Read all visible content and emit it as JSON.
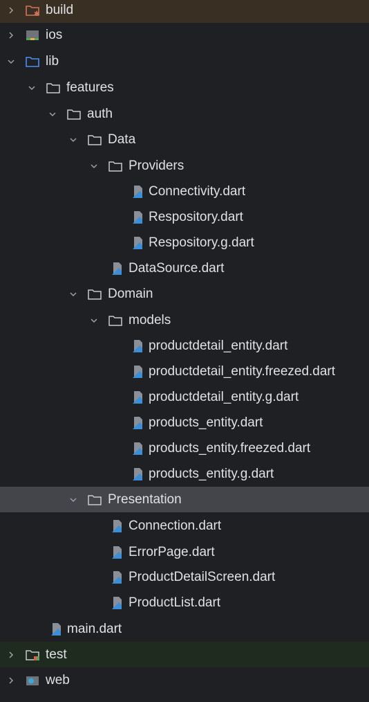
{
  "tree": {
    "rows": [
      {
        "label": "build",
        "kind": "folder-excluded",
        "expanded": false
      },
      {
        "label": "ios",
        "kind": "folder-ios",
        "expanded": false
      },
      {
        "label": "lib",
        "kind": "folder-source",
        "expanded": true
      },
      {
        "label": "features",
        "kind": "folder",
        "expanded": true
      },
      {
        "label": "auth",
        "kind": "folder",
        "expanded": true
      },
      {
        "label": "Data",
        "kind": "folder",
        "expanded": true
      },
      {
        "label": "Providers",
        "kind": "folder",
        "expanded": true
      },
      {
        "label": "Connectivity.dart",
        "kind": "dart-file"
      },
      {
        "label": "Respository.dart",
        "kind": "dart-file"
      },
      {
        "label": "Respository.g.dart",
        "kind": "dart-file"
      },
      {
        "label": "DataSource.dart",
        "kind": "dart-file"
      },
      {
        "label": "Domain",
        "kind": "folder",
        "expanded": true
      },
      {
        "label": "models",
        "kind": "folder",
        "expanded": true
      },
      {
        "label": "productdetail_entity.dart",
        "kind": "dart-file"
      },
      {
        "label": "productdetail_entity.freezed.dart",
        "kind": "dart-file"
      },
      {
        "label": "productdetail_entity.g.dart",
        "kind": "dart-file"
      },
      {
        "label": "products_entity.dart",
        "kind": "dart-file"
      },
      {
        "label": "products_entity.freezed.dart",
        "kind": "dart-file"
      },
      {
        "label": "products_entity.g.dart",
        "kind": "dart-file"
      },
      {
        "label": "Presentation",
        "kind": "folder",
        "expanded": true,
        "selected": true
      },
      {
        "label": "Connection.dart",
        "kind": "dart-file"
      },
      {
        "label": "ErrorPage.dart",
        "kind": "dart-file"
      },
      {
        "label": "ProductDetailScreen.dart",
        "kind": "dart-file"
      },
      {
        "label": "ProductList.dart",
        "kind": "dart-file"
      },
      {
        "label": "main.dart",
        "kind": "dart-file"
      },
      {
        "label": "test",
        "kind": "folder-test",
        "expanded": false
      },
      {
        "label": "web",
        "kind": "folder-web",
        "expanded": false
      }
    ]
  },
  "colors": {
    "background": "#1f2023",
    "text": "#dfe1e5",
    "selected_row": "#43454a",
    "build_row": "#3a2f23",
    "source_folder_blue": "#4d8ff5",
    "dart_blue": "#3b8fd8",
    "dart_gray": "#8a8f98"
  }
}
